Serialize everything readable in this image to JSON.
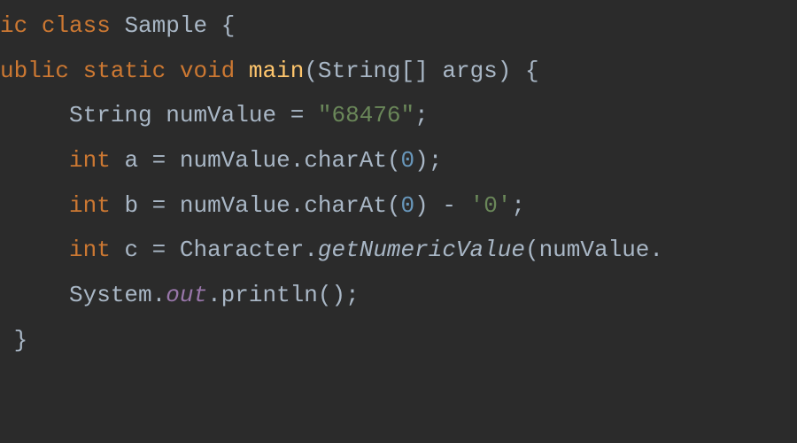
{
  "code": {
    "lines": [
      {
        "indent": "",
        "tokens": [
          {
            "text": "ic",
            "class": "tok-keyword",
            "bind": "code.lines.0.t0"
          },
          {
            "text": " ",
            "class": "",
            "bind": "code.lines.0.s0"
          },
          {
            "text": "class",
            "class": "tok-keyword",
            "bind": "code.lines.0.t1"
          },
          {
            "text": " ",
            "class": "",
            "bind": "code.lines.0.s1"
          },
          {
            "text": "Sample",
            "class": "tok-class-name",
            "bind": "code.lines.0.t2"
          },
          {
            "text": " ",
            "class": "",
            "bind": "code.lines.0.s2"
          },
          {
            "text": "{",
            "class": "tok-brace",
            "bind": "code.lines.0.t3"
          }
        ]
      },
      {
        "indent": "",
        "tokens": [
          {
            "text": "ublic",
            "class": "tok-keyword",
            "bind": "code.lines.1.t0"
          },
          {
            "text": " ",
            "class": "",
            "bind": "code.lines.1.s0"
          },
          {
            "text": "static",
            "class": "tok-keyword",
            "bind": "code.lines.1.t1"
          },
          {
            "text": " ",
            "class": "",
            "bind": "code.lines.1.s1"
          },
          {
            "text": "void",
            "class": "tok-keyword",
            "bind": "code.lines.1.t2"
          },
          {
            "text": " ",
            "class": "",
            "bind": "code.lines.1.s2"
          },
          {
            "text": "main",
            "class": "tok-method-decl",
            "bind": "code.lines.1.t3"
          },
          {
            "text": "(",
            "class": "tok-paren",
            "bind": "code.lines.1.t4"
          },
          {
            "text": "String",
            "class": "tok-type",
            "bind": "code.lines.1.t5"
          },
          {
            "text": "[]",
            "class": "tok-punct",
            "bind": "code.lines.1.t6"
          },
          {
            "text": " ",
            "class": "",
            "bind": "code.lines.1.s3"
          },
          {
            "text": "args",
            "class": "tok-identifier",
            "bind": "code.lines.1.t7"
          },
          {
            "text": ")",
            "class": "tok-paren",
            "bind": "code.lines.1.t8"
          },
          {
            "text": " ",
            "class": "",
            "bind": "code.lines.1.s4"
          },
          {
            "text": "{",
            "class": "tok-brace",
            "bind": "code.lines.1.t9"
          }
        ]
      },
      {
        "indent": "     ",
        "tokens": [
          {
            "text": "String",
            "class": "tok-type",
            "bind": "code.lines.2.t0"
          },
          {
            "text": " ",
            "class": "",
            "bind": "code.lines.2.s0"
          },
          {
            "text": "numValue",
            "class": "tok-var-decl",
            "bind": "code.lines.2.t1"
          },
          {
            "text": " ",
            "class": "",
            "bind": "code.lines.2.s1"
          },
          {
            "text": "=",
            "class": "tok-operator",
            "bind": "code.lines.2.t2"
          },
          {
            "text": " ",
            "class": "",
            "bind": "code.lines.2.s2"
          },
          {
            "text": "\"68476\"",
            "class": "tok-string",
            "bind": "code.lines.2.t3"
          },
          {
            "text": ";",
            "class": "tok-punct",
            "bind": "code.lines.2.t4"
          }
        ]
      },
      {
        "indent": "     ",
        "tokens": [
          {
            "text": "int",
            "class": "tok-keyword",
            "bind": "code.lines.3.t0"
          },
          {
            "text": " ",
            "class": "",
            "bind": "code.lines.3.s0"
          },
          {
            "text": "a",
            "class": "tok-var-decl",
            "bind": "code.lines.3.t1"
          },
          {
            "text": " ",
            "class": "",
            "bind": "code.lines.3.s1"
          },
          {
            "text": "=",
            "class": "tok-operator",
            "bind": "code.lines.3.t2"
          },
          {
            "text": " ",
            "class": "",
            "bind": "code.lines.3.s2"
          },
          {
            "text": "numValue",
            "class": "tok-identifier",
            "bind": "code.lines.3.t3"
          },
          {
            "text": ".",
            "class": "tok-dot",
            "bind": "code.lines.3.t4"
          },
          {
            "text": "charAt",
            "class": "tok-method-call",
            "bind": "code.lines.3.t5"
          },
          {
            "text": "(",
            "class": "tok-paren",
            "bind": "code.lines.3.t6"
          },
          {
            "text": "0",
            "class": "tok-number",
            "bind": "code.lines.3.t7"
          },
          {
            "text": ")",
            "class": "tok-paren",
            "bind": "code.lines.3.t8"
          },
          {
            "text": ";",
            "class": "tok-punct",
            "bind": "code.lines.3.t9"
          }
        ]
      },
      {
        "indent": "     ",
        "tokens": [
          {
            "text": "int",
            "class": "tok-keyword",
            "bind": "code.lines.4.t0"
          },
          {
            "text": " ",
            "class": "",
            "bind": "code.lines.4.s0"
          },
          {
            "text": "b",
            "class": "tok-var-decl",
            "bind": "code.lines.4.t1"
          },
          {
            "text": " ",
            "class": "",
            "bind": "code.lines.4.s1"
          },
          {
            "text": "=",
            "class": "tok-operator",
            "bind": "code.lines.4.t2"
          },
          {
            "text": " ",
            "class": "",
            "bind": "code.lines.4.s2"
          },
          {
            "text": "numValue",
            "class": "tok-identifier",
            "bind": "code.lines.4.t3"
          },
          {
            "text": ".",
            "class": "tok-dot",
            "bind": "code.lines.4.t4"
          },
          {
            "text": "charAt",
            "class": "tok-method-call",
            "bind": "code.lines.4.t5"
          },
          {
            "text": "(",
            "class": "tok-paren",
            "bind": "code.lines.4.t6"
          },
          {
            "text": "0",
            "class": "tok-number",
            "bind": "code.lines.4.t7"
          },
          {
            "text": ")",
            "class": "tok-paren",
            "bind": "code.lines.4.t8"
          },
          {
            "text": " ",
            "class": "",
            "bind": "code.lines.4.s3"
          },
          {
            "text": "-",
            "class": "tok-operator",
            "bind": "code.lines.4.t9"
          },
          {
            "text": " ",
            "class": "",
            "bind": "code.lines.4.s4"
          },
          {
            "text": "'0'",
            "class": "tok-char",
            "bind": "code.lines.4.t10"
          },
          {
            "text": ";",
            "class": "tok-punct",
            "bind": "code.lines.4.t11"
          }
        ]
      },
      {
        "indent": "     ",
        "tokens": [
          {
            "text": "int",
            "class": "tok-keyword",
            "bind": "code.lines.5.t0"
          },
          {
            "text": " ",
            "class": "",
            "bind": "code.lines.5.s0"
          },
          {
            "text": "c",
            "class": "tok-var-decl",
            "bind": "code.lines.5.t1"
          },
          {
            "text": " ",
            "class": "",
            "bind": "code.lines.5.s1"
          },
          {
            "text": "=",
            "class": "tok-operator",
            "bind": "code.lines.5.t2"
          },
          {
            "text": " ",
            "class": "",
            "bind": "code.lines.5.s2"
          },
          {
            "text": "Character",
            "class": "tok-type",
            "bind": "code.lines.5.t3"
          },
          {
            "text": ".",
            "class": "tok-dot",
            "bind": "code.lines.5.t4"
          },
          {
            "text": "getNumericValue",
            "class": "tok-static-call",
            "bind": "code.lines.5.t5"
          },
          {
            "text": "(",
            "class": "tok-paren",
            "bind": "code.lines.5.t6"
          },
          {
            "text": "numValue",
            "class": "tok-identifier",
            "bind": "code.lines.5.t7"
          },
          {
            "text": ".",
            "class": "tok-dot",
            "bind": "code.lines.5.t8"
          }
        ]
      },
      {
        "indent": "     ",
        "tokens": [
          {
            "text": "System",
            "class": "tok-type",
            "bind": "code.lines.6.t0"
          },
          {
            "text": ".",
            "class": "tok-dot",
            "bind": "code.lines.6.t1"
          },
          {
            "text": "out",
            "class": "tok-static-field",
            "bind": "code.lines.6.t2"
          },
          {
            "text": ".",
            "class": "tok-dot",
            "bind": "code.lines.6.t3"
          },
          {
            "text": "println",
            "class": "tok-method-call",
            "bind": "code.lines.6.t4"
          },
          {
            "text": "(",
            "class": "tok-paren",
            "bind": "code.lines.6.t5"
          },
          {
            "text": ")",
            "class": "tok-paren",
            "bind": "code.lines.6.t6"
          },
          {
            "text": ";",
            "class": "tok-punct",
            "bind": "code.lines.6.t7"
          }
        ]
      },
      {
        "indent": " ",
        "tokens": [
          {
            "text": "}",
            "class": "tok-brace",
            "bind": "code.lines.7.t0"
          }
        ]
      }
    ]
  },
  "flat": {}
}
